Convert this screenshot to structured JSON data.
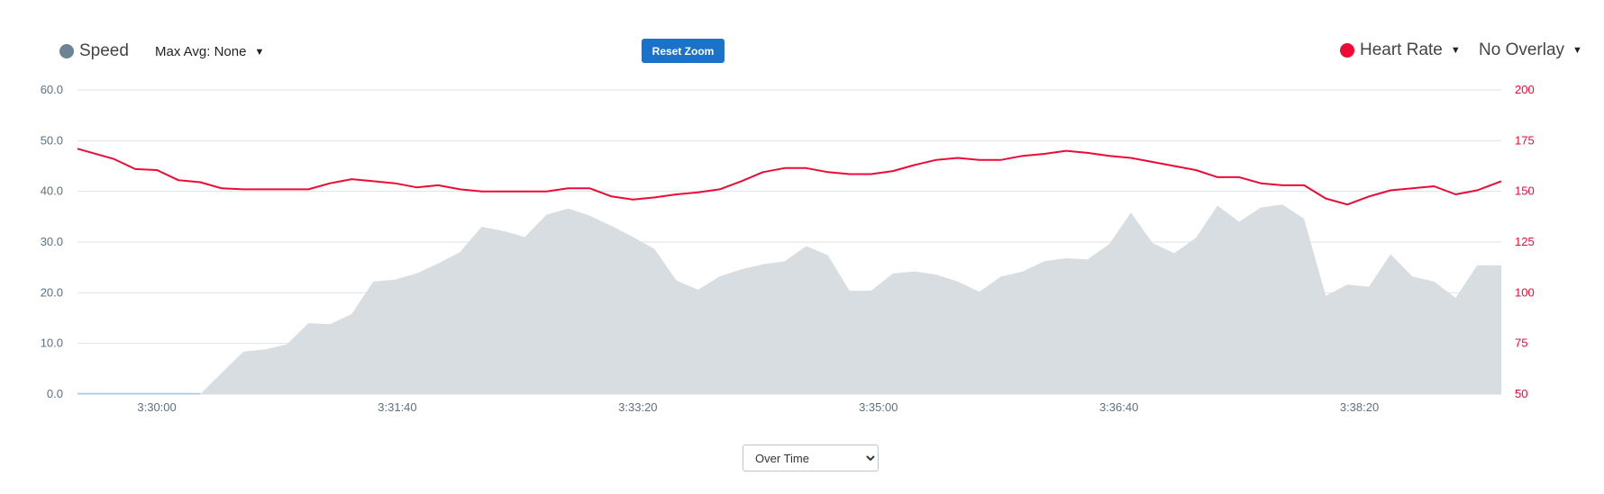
{
  "controls": {
    "speed_label": "Speed",
    "max_avg_label": "Max Avg: None",
    "reset_zoom_label": "Reset Zoom",
    "heart_rate_label": "Heart Rate",
    "overlay_label": "No Overlay",
    "mode_options": [
      "Over Time"
    ],
    "mode_selected": "Over Time"
  },
  "colors": {
    "speed": "#6e8494",
    "speed_fill": "#d8dde2",
    "heart_rate": "#ef0a35",
    "axis_left": "#5d7080",
    "grid": "#dde2e7",
    "button": "#1a73c9"
  },
  "icons": {
    "caret": "caret-down-icon",
    "series_marker": "circle-icon"
  },
  "chart_data": {
    "type": "area",
    "x_ticks": [
      "3:30:00",
      "3:31:40",
      "3:33:20",
      "3:35:00",
      "3:36:40",
      "3:38:20"
    ],
    "x_tick_seconds": [
      12600,
      12700,
      12800,
      12900,
      13000,
      13100
    ],
    "xlim_seconds": [
      12567,
      13159
    ],
    "left_axis": {
      "ticks": [
        "0.0",
        "10.0",
        "20.0",
        "30.0",
        "40.0",
        "50.0",
        "60.0"
      ],
      "ylim": [
        0,
        60
      ]
    },
    "right_axis": {
      "ticks": [
        "50",
        "75",
        "100",
        "125",
        "150",
        "175",
        "200"
      ],
      "ylim": [
        50,
        200
      ]
    },
    "grid": true,
    "series": [
      {
        "name": "Speed",
        "axis": "left",
        "type": "area",
        "x": [
          12567,
          12618,
          12636,
          12645,
          12654,
          12663,
          12672,
          12681,
          12690,
          12699,
          12708,
          12717,
          12726,
          12735,
          12744,
          12753,
          12762,
          12771,
          12780,
          12789,
          12798,
          12807,
          12816,
          12825,
          12834,
          12843,
          12852,
          12861,
          12870,
          12879,
          12888,
          12897,
          12906,
          12915,
          12924,
          12933,
          12942,
          12951,
          12960,
          12969,
          12978,
          12987,
          12996,
          13005,
          13014,
          13023,
          13032,
          13041,
          13050,
          13059,
          13068,
          13077,
          13086,
          13095,
          13104,
          13113,
          13122,
          13131,
          13140,
          13149,
          13159
        ],
        "y": [
          0,
          0,
          8.4,
          8.8,
          9.8,
          14,
          13.8,
          15.8,
          22.2,
          22.6,
          23.8,
          25.8,
          28,
          33,
          32.2,
          31,
          35.4,
          36.6,
          35.2,
          33.2,
          31,
          28.6,
          22.4,
          20.6,
          23.2,
          24.6,
          25.6,
          26.2,
          29.2,
          27.4,
          20.4,
          20.4,
          23.8,
          24.2,
          23.6,
          22.2,
          20.2,
          23.2,
          24.2,
          26.2,
          26.8,
          26.6,
          29.6,
          35.8,
          29.8,
          27.8,
          30.8,
          37.2,
          34,
          36.8,
          37.4,
          34.6,
          19.4,
          21.6,
          21.2,
          27.6,
          23.2,
          22.2,
          19,
          25.4,
          25.4
        ]
      },
      {
        "name": "Heart Rate",
        "axis": "right",
        "type": "line",
        "x": [
          12567,
          12582,
          12591,
          12600,
          12609,
          12618,
          12627,
          12636,
          12645,
          12654,
          12663,
          12672,
          12681,
          12690,
          12699,
          12708,
          12717,
          12726,
          12735,
          12744,
          12753,
          12762,
          12771,
          12780,
          12789,
          12798,
          12807,
          12816,
          12825,
          12834,
          12843,
          12852,
          12861,
          12870,
          12879,
          12888,
          12897,
          12906,
          12915,
          12924,
          12933,
          12942,
          12951,
          12960,
          12969,
          12978,
          12987,
          12996,
          13005,
          13014,
          13023,
          13032,
          13041,
          13050,
          13059,
          13068,
          13077,
          13086,
          13095,
          13104,
          13113,
          13122,
          13131,
          13140,
          13149,
          13159
        ],
        "y": [
          171,
          166,
          161,
          160.5,
          155.5,
          154.5,
          151.5,
          151,
          151,
          151,
          151,
          154,
          156,
          155,
          154,
          152,
          153,
          151,
          150,
          150,
          150,
          150,
          151.5,
          151.5,
          147.5,
          146,
          147,
          148.5,
          149.5,
          151,
          155,
          159.5,
          161.5,
          161.5,
          159.5,
          158.5,
          158.5,
          160,
          163,
          165.5,
          166.5,
          165.5,
          165.5,
          167.5,
          168.5,
          170,
          169,
          167.5,
          166.5,
          164.5,
          162.5,
          160.5,
          157,
          157,
          154,
          153,
          153,
          146.5,
          143.5,
          147.5,
          150.5,
          151.5,
          152.5,
          148.5,
          150.5,
          155
        ]
      }
    ]
  }
}
